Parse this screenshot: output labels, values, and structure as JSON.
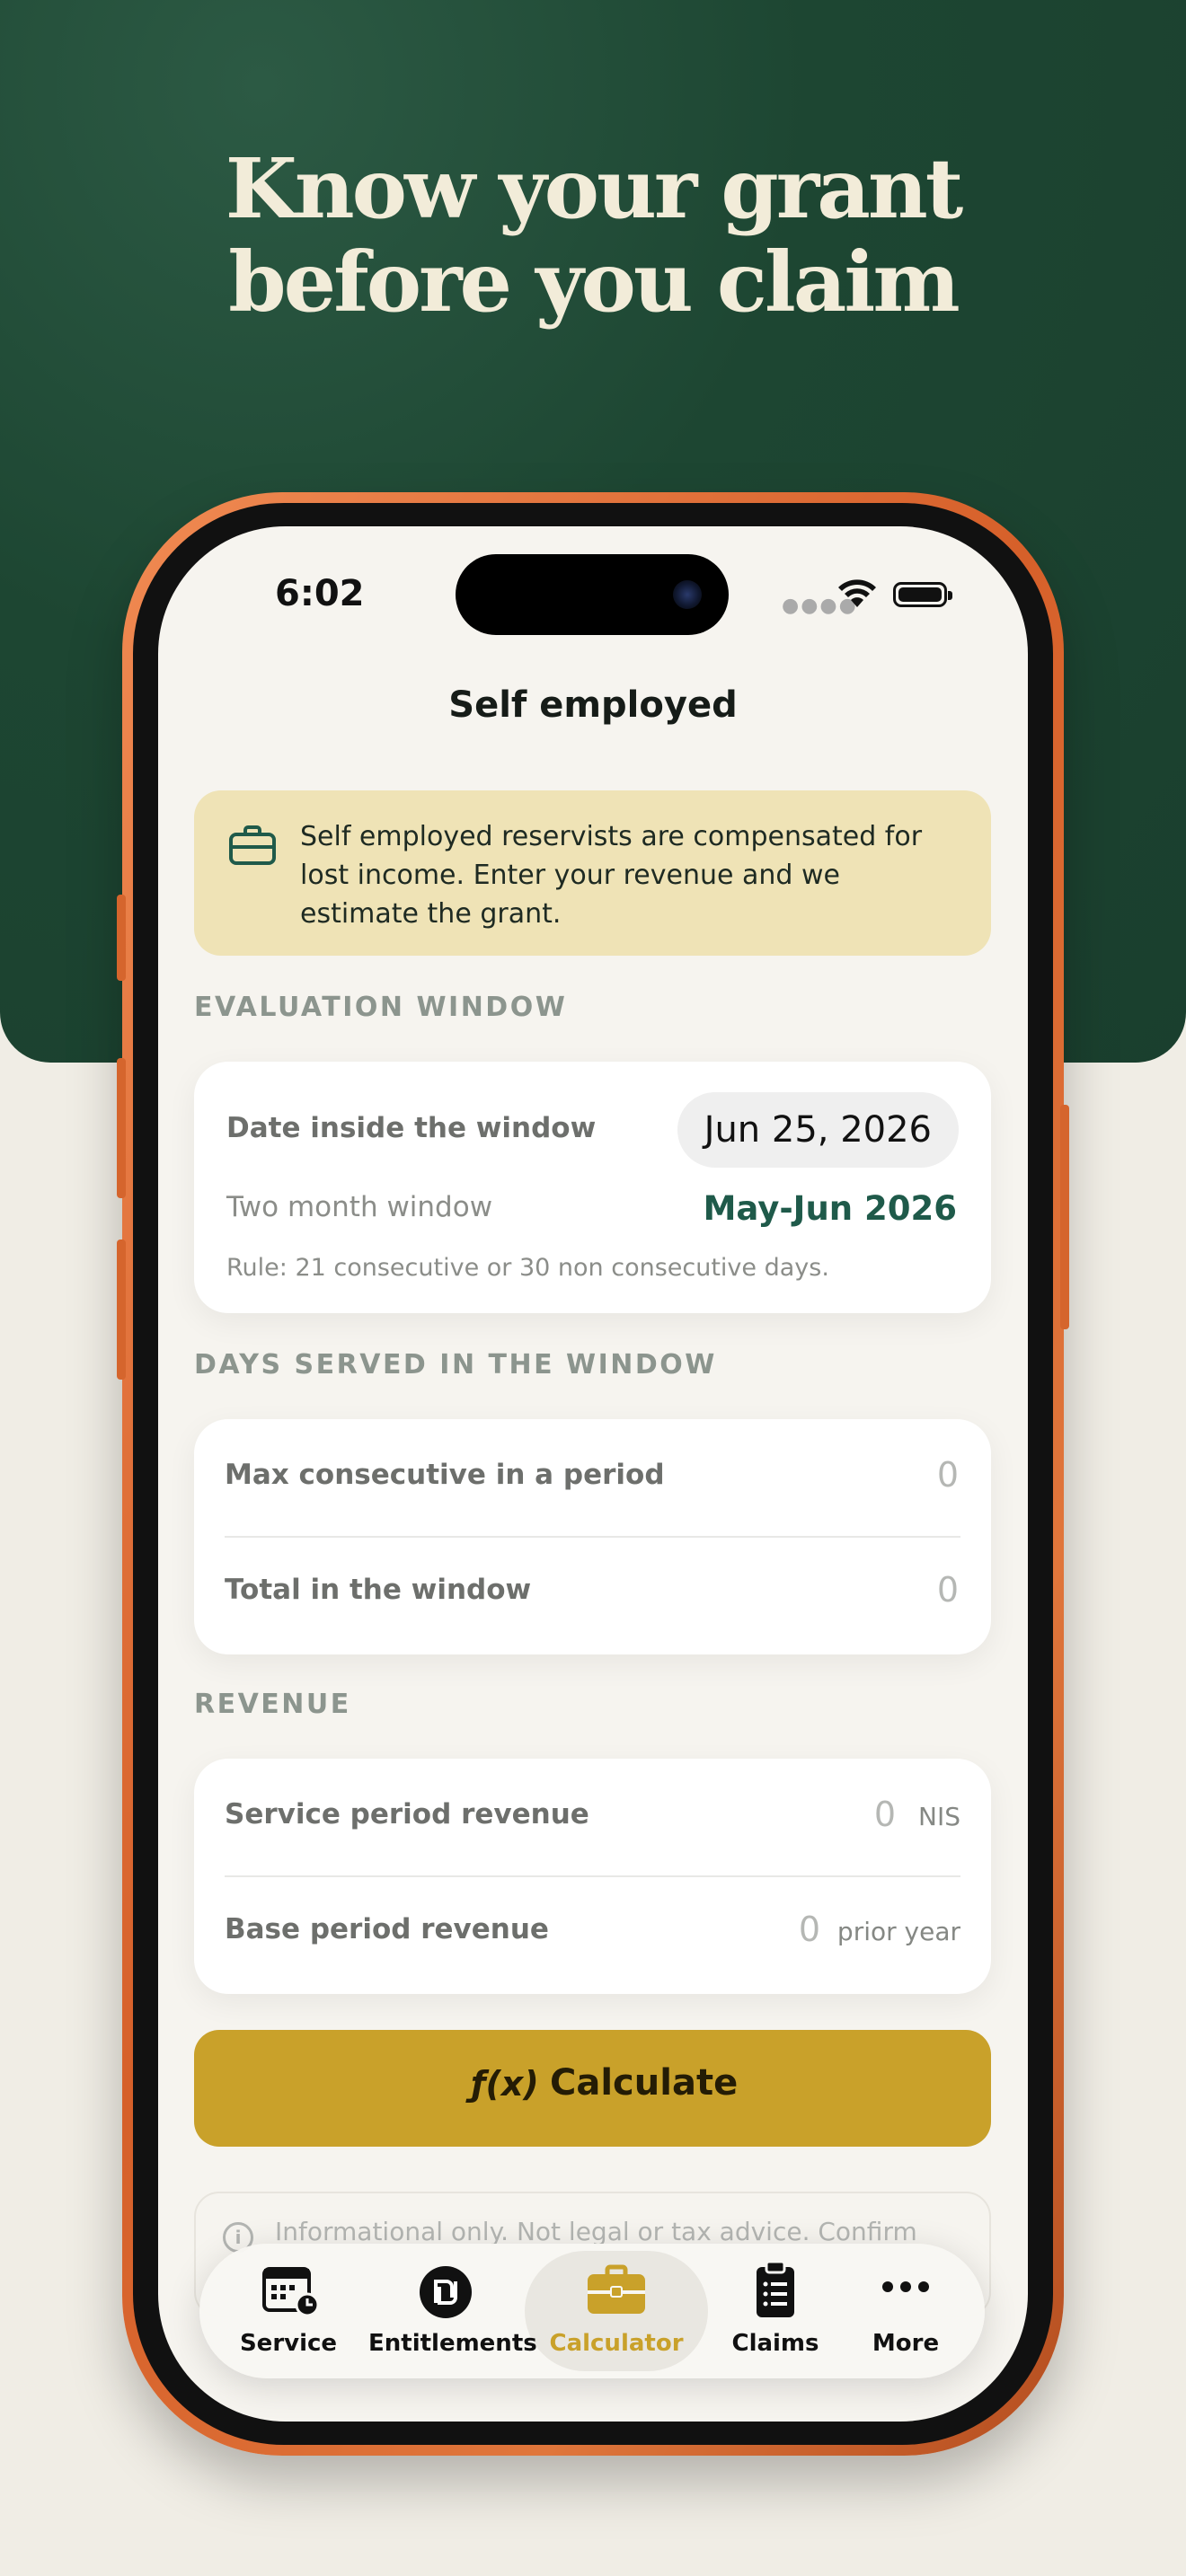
{
  "hero": {
    "line1": "Know your grant",
    "line2": "before you claim"
  },
  "status_bar": {
    "time": "6:02"
  },
  "nav": {
    "title": "Self employed"
  },
  "banner": {
    "text": "Self employed reservists are compensated for lost income. Enter your revenue and we estimate the grant.",
    "icon": "briefcase-icon"
  },
  "evaluation": {
    "section_label": "EVALUATION WINDOW",
    "date_label": "Date inside the window",
    "date_value": "Jun 25, 2026",
    "window_label": "Two month window",
    "window_value": "May-Jun 2026",
    "rule": "Rule: 21 consecutive or 30 non consecutive days."
  },
  "days": {
    "section_label": "DAYS SERVED IN THE WINDOW",
    "rows": [
      {
        "label": "Max consecutive in a period",
        "value": "0"
      },
      {
        "label": "Total in the window",
        "value": "0"
      }
    ]
  },
  "revenue": {
    "section_label": "REVENUE",
    "rows": [
      {
        "label": "Service period revenue",
        "value": "0",
        "unit": "NIS"
      },
      {
        "label": "Base period revenue",
        "value": "0",
        "unit": "prior year"
      }
    ]
  },
  "calculate": {
    "fx": "ƒ(x)",
    "label": "Calculate"
  },
  "disclaimer": {
    "text": "Informational only. Not legal or tax advice. Confirm"
  },
  "tabs": [
    {
      "label": "Service",
      "icon": "calendar-clock-icon"
    },
    {
      "label": "Entitlements",
      "icon": "shekel-icon"
    },
    {
      "label": "Calculator",
      "icon": "briefcase-icon",
      "active": true
    },
    {
      "label": "Claims",
      "icon": "clipboard-list-icon"
    },
    {
      "label": "More",
      "icon": "more-dots-icon"
    }
  ],
  "colors": {
    "accent": "#c9a12a",
    "brand_green": "#1d4632",
    "banner_bg": "#efe3b6",
    "window_value": "#1f5a4a"
  }
}
